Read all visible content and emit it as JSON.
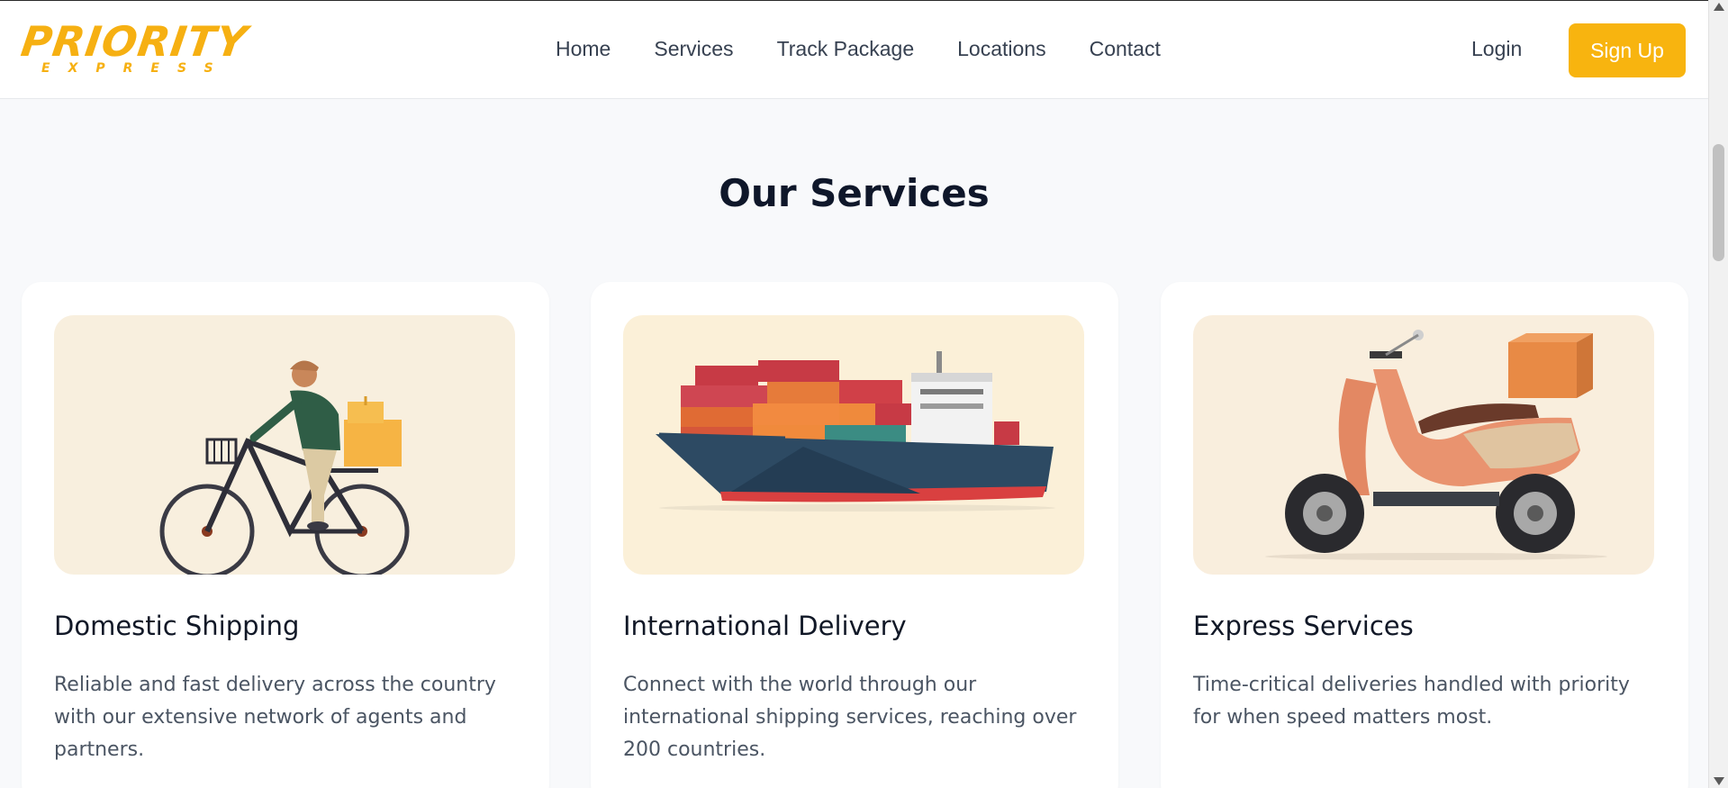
{
  "brand": {
    "name": "PRIORITY",
    "sub": "EXPRESS",
    "color": "#f6b012"
  },
  "nav": {
    "items": [
      "Home",
      "Services",
      "Track Package",
      "Locations",
      "Contact"
    ],
    "login_label": "Login",
    "signup_label": "Sign Up"
  },
  "section": {
    "title": "Our Services"
  },
  "cards": [
    {
      "title": "Domestic Shipping",
      "description": "Reliable and fast delivery across the country with our extensive network of agents and partners.",
      "image": "bicycle-courier-illustration"
    },
    {
      "title": "International Delivery",
      "description": "Connect with the world through our international shipping services, reaching over 200 countries.",
      "image": "cargo-ship-illustration"
    },
    {
      "title": "Express Services",
      "description": "Time-critical deliveries handled with priority for when speed matters most.",
      "image": "scooter-delivery-illustration"
    }
  ],
  "colors": {
    "accent": "#f8b40f",
    "page_bg": "#f8f9fb",
    "image_bg": "#f8efde"
  }
}
